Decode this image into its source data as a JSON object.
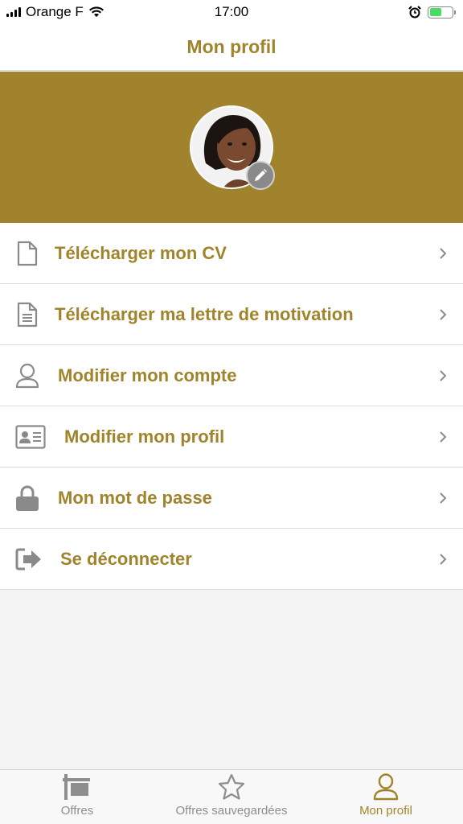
{
  "status_bar": {
    "carrier": "Orange F",
    "time": "17:00"
  },
  "header": {
    "title": "Mon profil"
  },
  "colors": {
    "accent": "#a0842c",
    "banner": "#a0832c",
    "icon_gray": "#8a8a8a",
    "battery_green": "#4cd964"
  },
  "profile": {
    "avatar_icon": "user-photo",
    "edit_icon": "pencil-icon"
  },
  "menu": {
    "items": [
      {
        "label": "Télécharger mon CV",
        "icon": "document-icon"
      },
      {
        "label": "Télécharger ma lettre de motivation",
        "icon": "document-text-icon"
      },
      {
        "label": "Modifier mon compte",
        "icon": "user-icon"
      },
      {
        "label": "Modifier mon profil",
        "icon": "id-card-icon"
      },
      {
        "label": "Mon mot de passe",
        "icon": "lock-icon"
      },
      {
        "label": "Se déconnecter",
        "icon": "sign-out-icon"
      }
    ]
  },
  "tabs": [
    {
      "label": "Offres",
      "icon": "flag-icon",
      "active": false
    },
    {
      "label": "Offres sauvegardées",
      "icon": "star-icon",
      "active": false
    },
    {
      "label": "Mon profil",
      "icon": "user-icon",
      "active": true
    }
  ]
}
